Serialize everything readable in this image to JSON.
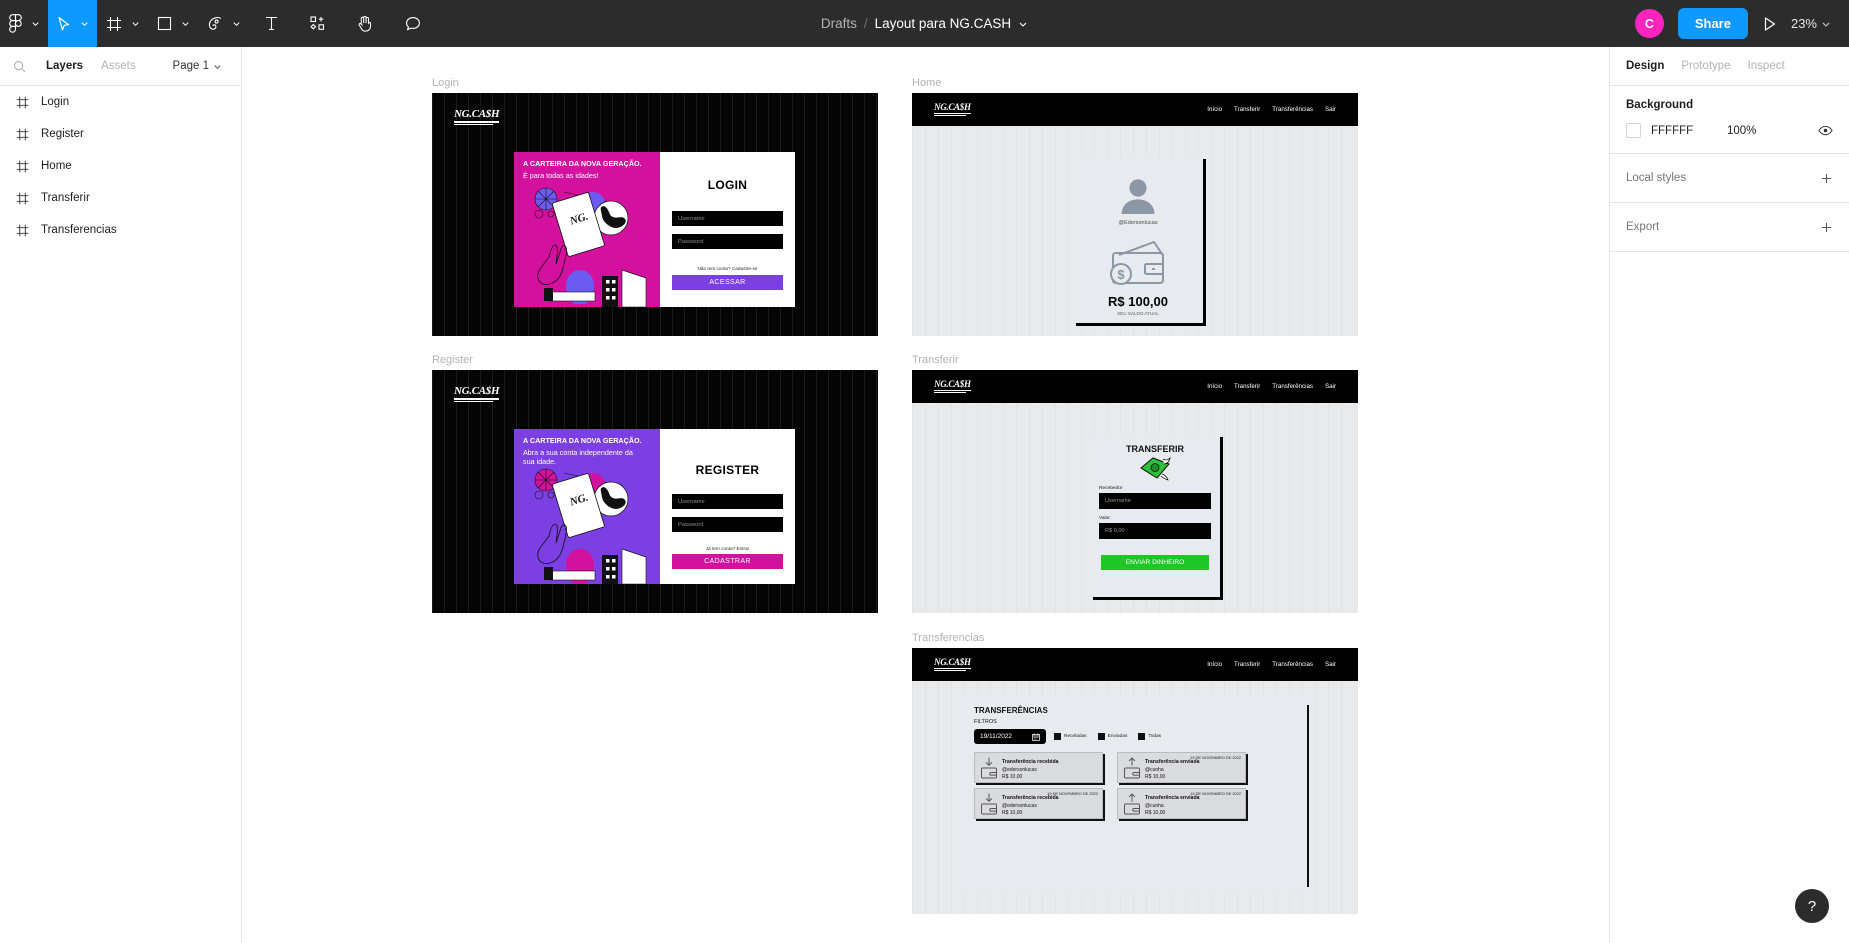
{
  "toolbar": {
    "tools": [
      {
        "name": "figma-menu-icon",
        "label": "Figma menu"
      },
      {
        "name": "move-tool-icon",
        "label": "Move"
      },
      {
        "name": "frame-tool-icon",
        "label": "Frame"
      },
      {
        "name": "shape-tool-icon",
        "label": "Shape"
      },
      {
        "name": "pen-tool-icon",
        "label": "Pen"
      },
      {
        "name": "text-tool-icon",
        "label": "Text"
      },
      {
        "name": "components-icon",
        "label": "Resources"
      },
      {
        "name": "hand-tool-icon",
        "label": "Hand"
      },
      {
        "name": "comment-tool-icon",
        "label": "Comment"
      }
    ],
    "breadcrumb_project": "Drafts",
    "breadcrumb_separator": "/",
    "file_name": "Layout para NG.CASH",
    "avatar_initial": "C",
    "share_label": "Share",
    "present_label": "Present",
    "zoom_level": "23%"
  },
  "left_panel": {
    "search_placeholder": "Search",
    "tabs": [
      {
        "label": "Layers",
        "selected": true
      },
      {
        "label": "Assets",
        "selected": false
      }
    ],
    "page_selector": "Page 1",
    "layers": [
      {
        "label": "Login",
        "icon": "frame-icon"
      },
      {
        "label": "Register",
        "icon": "frame-icon"
      },
      {
        "label": "Home",
        "icon": "frame-icon"
      },
      {
        "label": "Transferir",
        "icon": "frame-icon"
      },
      {
        "label": "Transferencias",
        "icon": "frame-icon"
      }
    ]
  },
  "right_panel": {
    "tabs": [
      {
        "label": "Design",
        "selected": true
      },
      {
        "label": "Prototype",
        "selected": false
      },
      {
        "label": "Inspect",
        "selected": false
      }
    ],
    "background": {
      "title": "Background",
      "hex": "FFFFFF",
      "opacity": "100%",
      "color": "#FFFFFF"
    },
    "local_styles": {
      "title": "Local styles"
    },
    "export": {
      "title": "Export"
    }
  },
  "canvas": {
    "help_label": "?",
    "frames": {
      "login": {
        "label": "Login",
        "logo": "NG.CA$H",
        "headline": "A CARTEIRA DA NOVA GERAÇÃO.",
        "subline": "É para todas as idades!",
        "accent_color": "#D4109E",
        "title": "LOGIN",
        "username_placeholder": "Username",
        "password_placeholder": "Password",
        "alt_text": "Não tem conta? Cadastre-se",
        "submit_label": "ACESSAR",
        "submit_color": "#7B3FE4"
      },
      "register": {
        "label": "Register",
        "logo": "NG.CA$H",
        "headline": "A CARTEIRA DA NOVA GERAÇÃO.",
        "subline": "Abra a sua conta independente da sua idade.",
        "accent_color": "#7B3FE4",
        "title": "REGISTER",
        "username_placeholder": "Username",
        "password_placeholder": "Password",
        "alt_text": "Já tem conta? Entrar",
        "submit_label": "CADASTRAR",
        "submit_color": "#D4109E"
      },
      "home": {
        "label": "Home",
        "logo": "NG.CA$H",
        "nav": [
          "Início",
          "Transferir",
          "Transferências",
          "Sair"
        ],
        "avatar_icon": "user-avatar-icon",
        "username": "@Edersonlucas",
        "wallet_icon": "wallet-icon",
        "balance": "R$ 100,00",
        "balance_caption": "SEU SALDO ATUAL"
      },
      "transferir": {
        "label": "Transferir",
        "logo": "NG.CA$H",
        "nav": [
          "Início",
          "Transferir",
          "Transferências",
          "Sair"
        ],
        "title": "TRANSFERIR",
        "money_icon": "money-fly-icon",
        "receiver_label": "Recebedor",
        "receiver_placeholder": "Username",
        "value_label": "Valor:",
        "value_placeholder": "R$ 0,00",
        "submit_label": "ENVIAR DINHEIRO",
        "submit_color": "#1EC626"
      },
      "transferencias": {
        "label": "Transferencias",
        "logo": "NG.CA$H",
        "nav": [
          "Início",
          "Transferir",
          "Transferências",
          "Sair"
        ],
        "title": "TRANSFERÊNCIAS",
        "filters_label": "FILTROS",
        "date_value": "19/11/2022",
        "calendar_icon": "calendar-icon",
        "filter_options": [
          "Recebidas",
          "Enviadas",
          "Todas"
        ],
        "transactions": [
          {
            "direction": "in",
            "icon": "arrow-down-wallet-icon",
            "title": "Transferência recebida",
            "user": "@edersonlucas",
            "amount": "R$ 10,00",
            "date": ""
          },
          {
            "direction": "out",
            "icon": "arrow-up-wallet-icon",
            "title": "Transferência enviada",
            "user": "@cunha",
            "amount": "R$ 10,00",
            "date": "19 DE NOVEMBRO DE 2022"
          },
          {
            "direction": "in",
            "icon": "arrow-down-wallet-icon",
            "title": "Transferência recebida",
            "user": "@edersonlucas",
            "amount": "R$ 10,00",
            "date": "19 DE NOVEMBRO DE 2022"
          },
          {
            "direction": "out",
            "icon": "arrow-up-wallet-icon",
            "title": "Transferência enviada",
            "user": "@cunha",
            "amount": "R$ 10,00",
            "date": "19 DE NOVEMBRO DE 2022"
          }
        ]
      }
    }
  }
}
